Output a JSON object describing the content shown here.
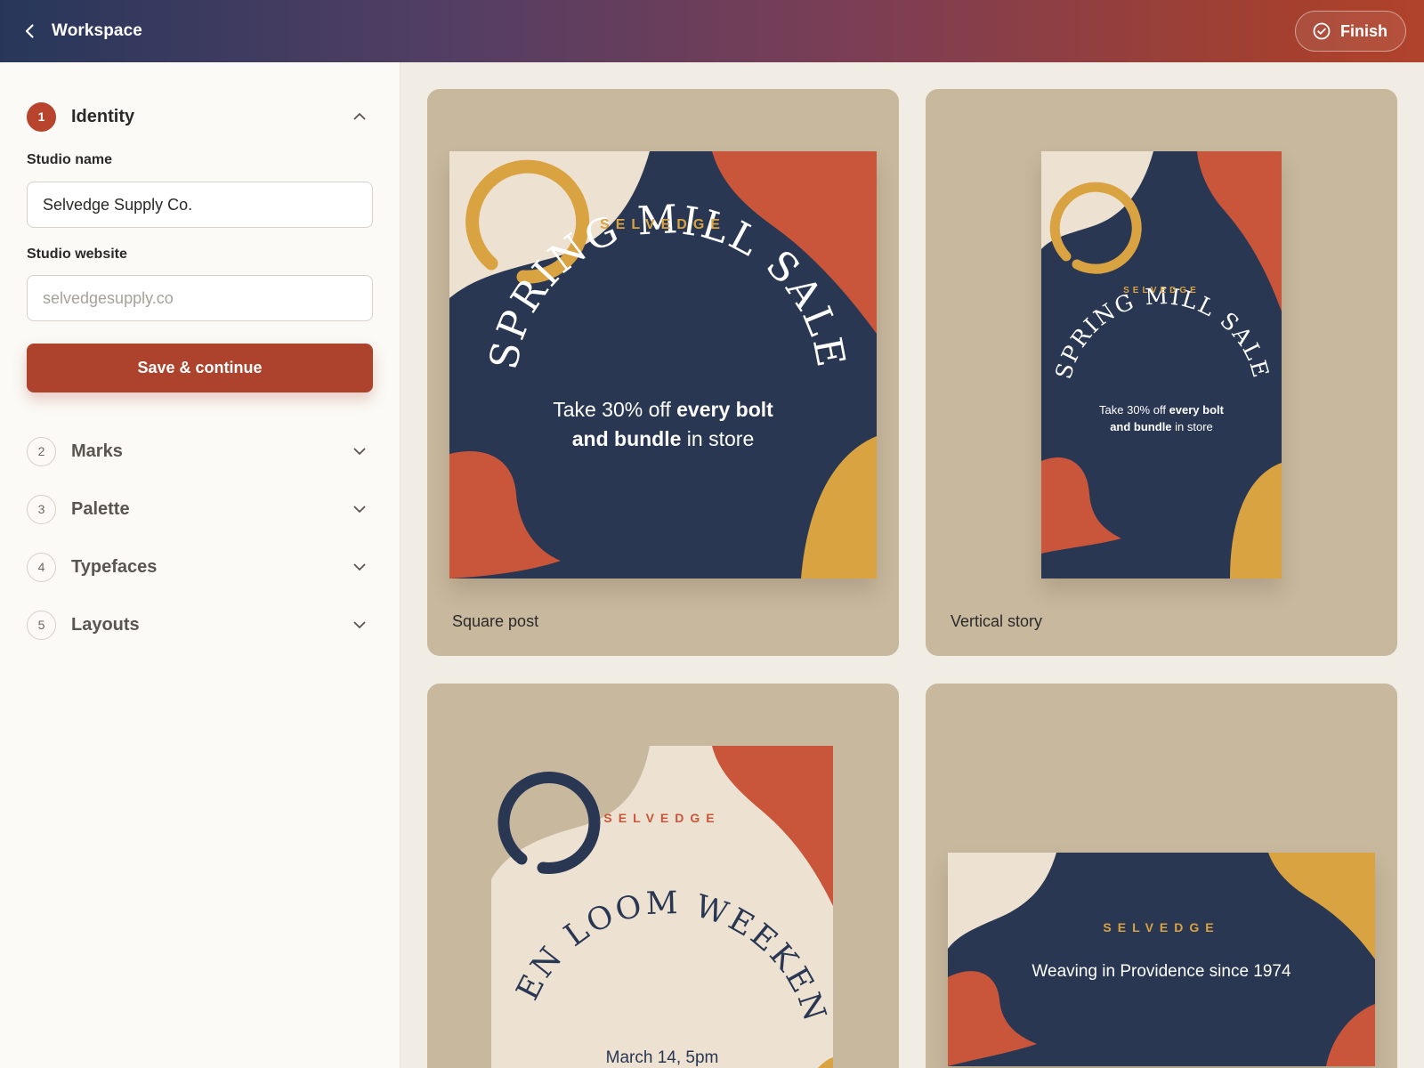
{
  "header": {
    "back_label": "Workspace",
    "finish_label": "Finish",
    "gradient": [
      "#27375a",
      "#7b3e55",
      "#b0432b"
    ]
  },
  "sidebar": {
    "steps": [
      {
        "num": "1",
        "title": "Identity",
        "expanded": true
      },
      {
        "num": "2",
        "title": "Marks",
        "expanded": false
      },
      {
        "num": "3",
        "title": "Palette",
        "expanded": false
      },
      {
        "num": "4",
        "title": "Typefaces",
        "expanded": false
      },
      {
        "num": "5",
        "title": "Layouts",
        "expanded": false
      }
    ],
    "identity": {
      "studio_name_label": "Studio name",
      "studio_name_value": "Selvedge Supply Co.",
      "studio_website_label": "Studio website",
      "studio_website_placeholder": "selvedgesupply.co",
      "save_label": "Save & continue"
    }
  },
  "palette": {
    "navy": "#293753",
    "cream": "#ede1d1",
    "terracotta": "#c9563a",
    "mustard": "#d9a341",
    "card_bg": "#c7b89e",
    "accent": "#ad432c"
  },
  "cards": [
    {
      "label": "Square post",
      "brand": "SELVEDGE",
      "headline": "SPRING MILL SALE",
      "body_pre": "Take 30% off ",
      "body_bold1": "every bolt",
      "body_bold2": "and bundle",
      "body_post": " in store"
    },
    {
      "label": "Vertical story",
      "brand": "SELVEDGE",
      "headline": "SPRING MILL SALE",
      "body_pre": "Take 30% off ",
      "body_bold1": "every bolt",
      "body_bold2": "and bundle",
      "body_post": " in store"
    },
    {
      "brand": "SELVEDGE",
      "headline": "OPEN LOOM WEEKEND",
      "date": "March 14, 5pm"
    },
    {
      "brand": "SELVEDGE",
      "tagline": "Weaving in Providence since 1974"
    }
  ]
}
